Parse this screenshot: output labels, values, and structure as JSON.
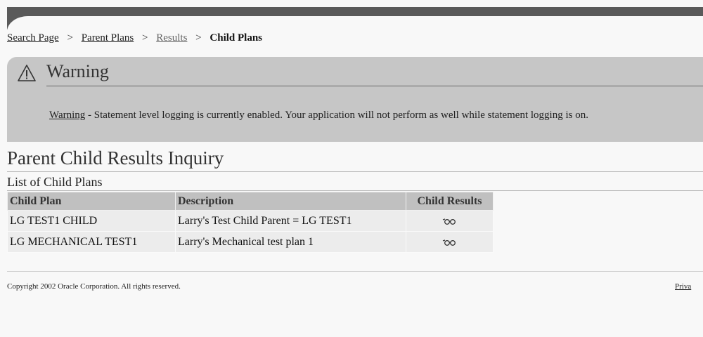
{
  "breadcrumb": {
    "items": [
      "Search Page",
      "Parent Plans",
      "Results",
      "Child Plans"
    ],
    "separator": ">"
  },
  "warning": {
    "title": "Warning",
    "label": "Warning",
    "message": " - Statement level logging is currently enabled. Your application will not perform as well while statement logging is on.",
    "icon": "warning-triangle-icon"
  },
  "page": {
    "title": "Parent Child Results Inquiry",
    "subheader": "List of Child Plans"
  },
  "table": {
    "columns": [
      "Child Plan",
      "Description",
      "Child Results"
    ],
    "rows": [
      {
        "child_plan": "LG TEST1 CHILD",
        "description": "Larry's Test Child Parent = LG TEST1",
        "results_icon": "glasses-icon"
      },
      {
        "child_plan": "LG MECHANICAL TEST1",
        "description": "Larry's Mechanical test plan 1",
        "results_icon": "glasses-icon"
      }
    ]
  },
  "footer": {
    "copyright": "Copyright 2002 Oracle Corporation. All rights reserved.",
    "privacy": "Priva"
  }
}
